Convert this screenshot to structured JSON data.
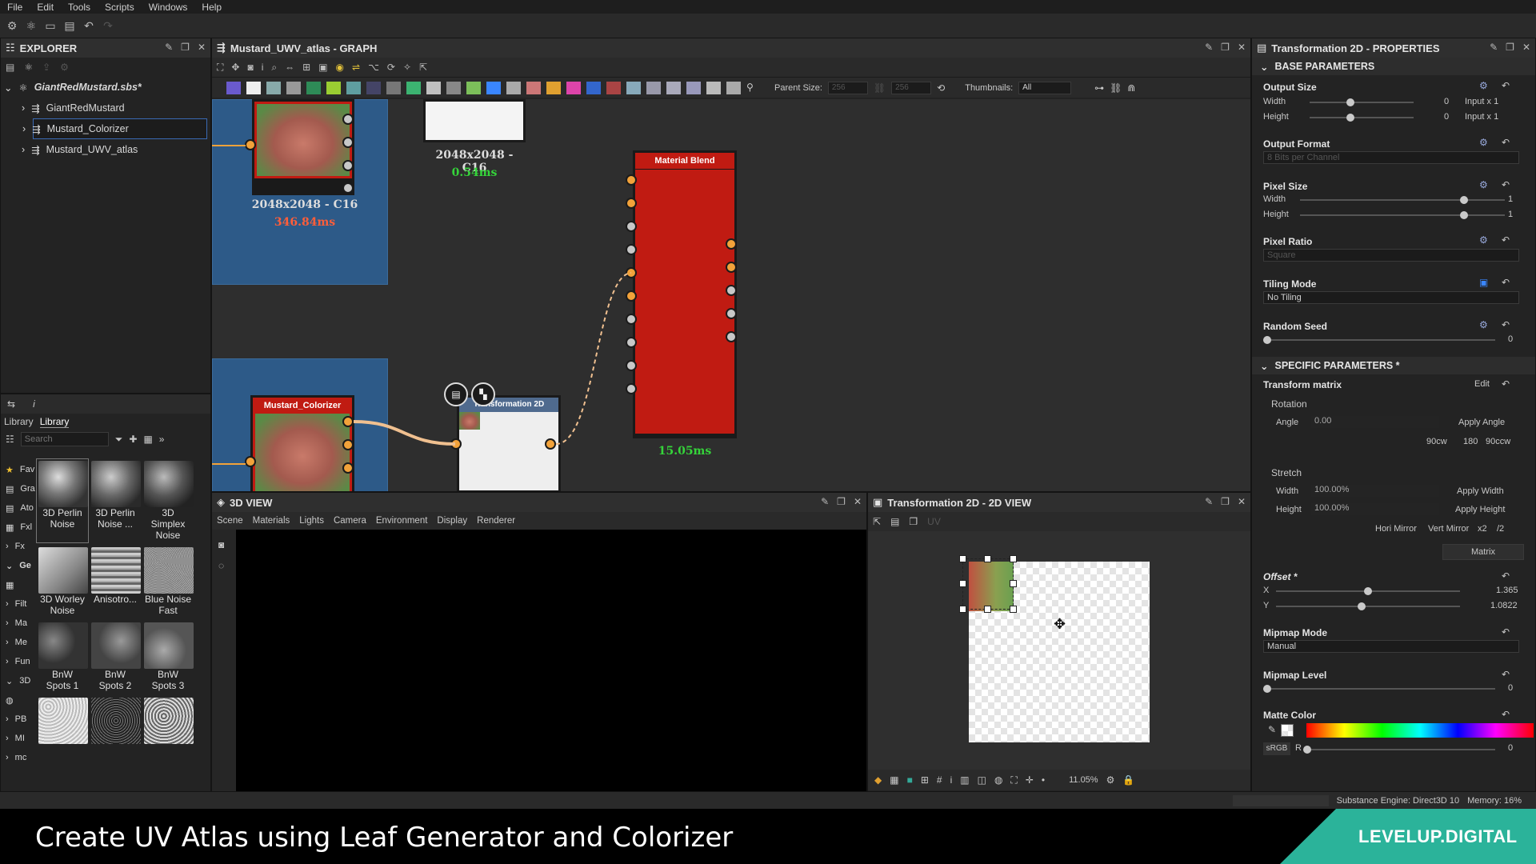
{
  "menu": [
    "File",
    "Edit",
    "Tools",
    "Scripts",
    "Windows",
    "Help"
  ],
  "explorer": {
    "title": "EXPLORER",
    "package": "GiantRedMustard.sbs*",
    "items": [
      "GiantRedMustard",
      "Mustard_Colorizer",
      "Mustard_UWV_atlas"
    ]
  },
  "library": {
    "tabs": [
      "Library",
      "Library"
    ],
    "search_placeholder": "Search",
    "categories": [
      "Fav",
      "Gra",
      "Ato",
      "Fxl",
      "Fx",
      "Ge",
      "Filt",
      "Ma",
      "Me",
      "Fun",
      "3D",
      "PB",
      "MI",
      "mc"
    ],
    "thumbs": [
      {
        "label": "3D Perlin Noise"
      },
      {
        "label": "3D Perlin Noise ..."
      },
      {
        "label": "3D Simplex Noise"
      },
      {
        "label": "3D Worley Noise"
      },
      {
        "label": "Anisotro..."
      },
      {
        "label": "Blue Noise Fast"
      },
      {
        "label": "BnW Spots 1"
      },
      {
        "label": "BnW Spots 2"
      },
      {
        "label": "BnW Spots 3"
      }
    ]
  },
  "graph": {
    "title": "Mustard_UWV_atlas - GRAPH",
    "parent_size_label": "Parent Size:",
    "parent_size_w": "256",
    "parent_size_h": "256",
    "thumbnails_label": "Thumbnails:",
    "thumbnails_value": "All",
    "nodes": {
      "top_left_res": "2048x2048 - C16",
      "top_left_time": "346.84ms",
      "top_mid_res": "2048x2048 - C16",
      "top_mid_time": "0.54ms",
      "blend_title": "Material Blend",
      "blend_time": "15.05ms",
      "colorizer_title": "Mustard_Colorizer",
      "transform_title": "Transformation 2D"
    }
  },
  "view3d": {
    "title": "3D VIEW",
    "menu": [
      "Scene",
      "Materials",
      "Lights",
      "Camera",
      "Environment",
      "Display",
      "Renderer"
    ]
  },
  "view2d": {
    "title": "Transformation 2D - 2D VIEW",
    "uv_label": "UV",
    "zoom": "11.05%"
  },
  "props": {
    "title": "Transformation 2D - PROPERTIES",
    "base": "BASE PARAMETERS",
    "specific": "SPECIFIC PARAMETERS *",
    "output_size": "Output Size",
    "width": "Width",
    "height": "Height",
    "os_w_val": "0",
    "os_w_mode": "Input x 1",
    "os_h_val": "0",
    "os_h_mode": "Input x 1",
    "output_format": "Output Format",
    "output_format_val": "8 Bits per Channel",
    "pixel_size": "Pixel Size",
    "ps_w": "1",
    "ps_h": "1",
    "pixel_ratio": "Pixel Ratio",
    "pixel_ratio_val": "Square",
    "tiling_mode": "Tiling Mode",
    "tiling_val": "No Tiling",
    "random_seed": "Random Seed",
    "seed_val": "0",
    "transform_matrix": "Transform matrix",
    "edit": "Edit",
    "rotation": "Rotation",
    "angle": "Angle",
    "angle_val": "0.00",
    "apply_angle": "Apply Angle",
    "rot_buttons": [
      "90cw",
      "180",
      "90ccw"
    ],
    "stretch": "Stretch",
    "st_w": "100.00%",
    "apply_width": "Apply Width",
    "st_h": "100.00%",
    "apply_height": "Apply Height",
    "mirror_buttons": [
      "Hori Mirror",
      "Vert Mirror",
      "x2",
      "/2"
    ],
    "matrix": "Matrix",
    "offset": "Offset *",
    "x": "X",
    "y": "Y",
    "off_x": "1.365",
    "off_y": "1.0822",
    "mipmap_mode": "Mipmap Mode",
    "mipmap_val": "Manual",
    "mipmap_level": "Mipmap Level",
    "mip_lvl": "0",
    "matte_color": "Matte Color",
    "srgb": "sRGB",
    "r": "R",
    "r_val": "0"
  },
  "status": {
    "engine": "Substance Engine: Direct3D 10",
    "memory": "Memory: 16%"
  },
  "banner": {
    "title": "Create UV Atlas using Leaf Generator and Colorizer",
    "brand": "LEVELUP.DIGITAL"
  },
  "colors": {
    "accent": "#f2a23a",
    "node_red": "#c01b12",
    "brand_teal": "#2bb39a",
    "timing_green": "#35d43a",
    "timing_red": "#ff5e3a"
  }
}
